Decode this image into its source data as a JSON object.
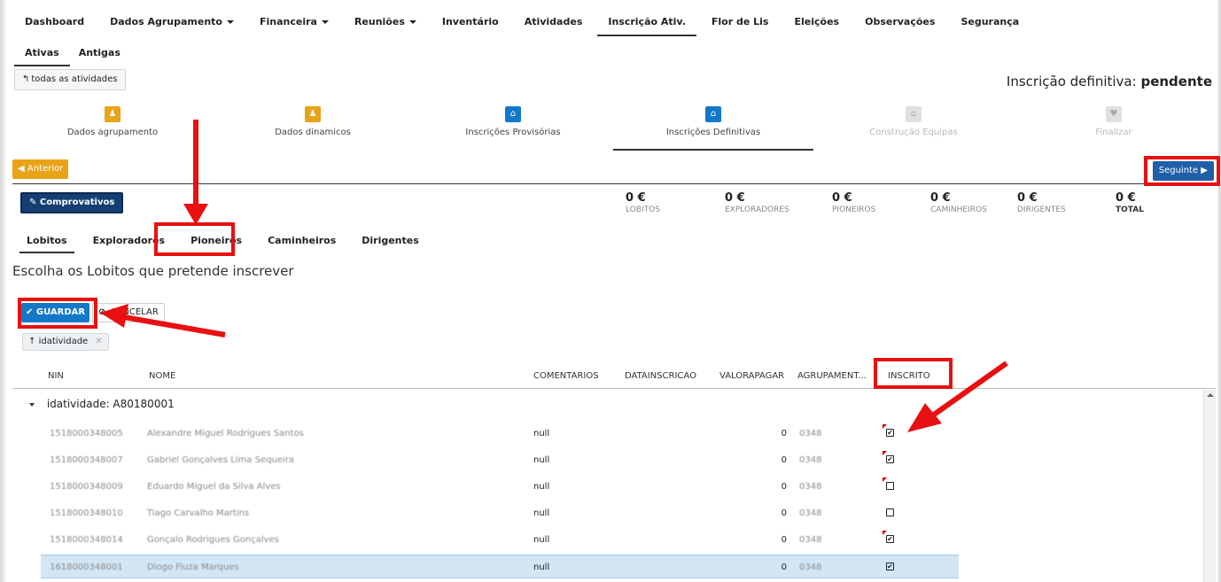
{
  "topnav": [
    {
      "label": "Dashboard",
      "caret": false,
      "active": false
    },
    {
      "label": "Dados Agrupamento",
      "caret": true,
      "active": false
    },
    {
      "label": "Financeira",
      "caret": true,
      "active": false
    },
    {
      "label": "Reuniões",
      "caret": true,
      "active": false
    },
    {
      "label": "Inventário",
      "caret": false,
      "active": false
    },
    {
      "label": "Atividades",
      "caret": false,
      "active": false
    },
    {
      "label": "Inscrição Ativ.",
      "caret": false,
      "active": true
    },
    {
      "label": "Flor de Lis",
      "caret": false,
      "active": false
    },
    {
      "label": "Eleições",
      "caret": false,
      "active": false
    },
    {
      "label": "Observações",
      "caret": false,
      "active": false
    },
    {
      "label": "Segurança",
      "caret": false,
      "active": false
    }
  ],
  "subtabs": [
    {
      "label": "Ativas",
      "active": true
    },
    {
      "label": "Antigas",
      "active": false
    }
  ],
  "back_button": "todas as atividades",
  "status": {
    "label": "Inscrição definitiva:",
    "value": "pendente"
  },
  "wizard": [
    {
      "label": "Dados agrupamento",
      "icon": "user-icon",
      "glyph": "♟",
      "color": "#e8a317",
      "state": "done"
    },
    {
      "label": "Dados dinamicos",
      "icon": "user-icon",
      "glyph": "♟",
      "color": "#e8a317",
      "state": "done"
    },
    {
      "label": "Inscrições Provisórias",
      "icon": "home-icon",
      "glyph": "⌂",
      "color": "#1478c8",
      "state": "done"
    },
    {
      "label": "Inscrições Definitivas",
      "icon": "home-icon",
      "glyph": "⌂",
      "color": "#1478c8",
      "state": "current"
    },
    {
      "label": "Construção Equipas",
      "icon": "home-icon",
      "glyph": "⌂",
      "color": "#e0e0e0",
      "state": "disabled"
    },
    {
      "label": "Finalizar",
      "icon": "heart-icon",
      "glyph": "♥",
      "color": "#e0e0e0",
      "state": "disabled"
    }
  ],
  "buttons": {
    "anterior": "Anterior",
    "seguinte": "Seguinte",
    "comprovativos": "Comprovativos",
    "guardar": "GUARDAR",
    "cancelar": "CANCELAR"
  },
  "totals": [
    {
      "amount": "0 €",
      "label": "LOBITOS"
    },
    {
      "amount": "0 €",
      "label": "EXPLORADORES"
    },
    {
      "amount": "0 €",
      "label": "PIONEIROS"
    },
    {
      "amount": "0 €",
      "label": "CAMINHEIROS"
    },
    {
      "amount": "0 €",
      "label": "DIRIGENTES"
    },
    {
      "amount": "0 €",
      "label": "TOTAL"
    }
  ],
  "section_tabs": [
    {
      "label": "Lobitos",
      "active": true
    },
    {
      "label": "Exploradores",
      "active": false
    },
    {
      "label": "Pioneiros",
      "active": false
    },
    {
      "label": "Caminheiros",
      "active": false
    },
    {
      "label": "Dirigentes",
      "active": false
    }
  ],
  "instruction": "Escolha os Lobitos que pretende inscrever",
  "group_chip": "idatividade",
  "columns": [
    "NIN",
    "NOME",
    "COMENTARIOS",
    "DATAINSCRICAO",
    "VALORAPAGAR",
    "AGRUPAMENT...",
    "INSCRITO"
  ],
  "group_label": "idatividade: A80180001",
  "rows": [
    {
      "nin": "1518000348005",
      "nome": "Alexandre Miguel Rodrigues Santos",
      "comentarios": "null",
      "datainscricao": "",
      "valor": "0",
      "agrupamento": "0348",
      "inscrito": true,
      "dirty": true,
      "selected": false
    },
    {
      "nin": "1518000348007",
      "nome": "Gabriel Gonçalves Lima Sequeira",
      "comentarios": "null",
      "datainscricao": "",
      "valor": "0",
      "agrupamento": "0348",
      "inscrito": true,
      "dirty": true,
      "selected": false
    },
    {
      "nin": "1518000348009",
      "nome": "Eduardo Miguel da Silva Alves",
      "comentarios": "null",
      "datainscricao": "",
      "valor": "0",
      "agrupamento": "0348",
      "inscrito": false,
      "dirty": true,
      "selected": false
    },
    {
      "nin": "1518000348010",
      "nome": "Tiago Carvalho Martins",
      "comentarios": "null",
      "datainscricao": "",
      "valor": "0",
      "agrupamento": "0348",
      "inscrito": false,
      "dirty": false,
      "selected": false
    },
    {
      "nin": "1518000348014",
      "nome": "Gonçalo Rodrigues Gonçalves",
      "comentarios": "null",
      "datainscricao": "",
      "valor": "0",
      "agrupamento": "0348",
      "inscrito": true,
      "dirty": true,
      "selected": false
    },
    {
      "nin": "1618000348001",
      "nome": "Diogo Fiuza Marques",
      "comentarios": "null",
      "datainscricao": "",
      "valor": "0",
      "agrupamento": "0348",
      "inscrito": true,
      "dirty": false,
      "selected": true
    }
  ],
  "annotation_color": "#e81010"
}
